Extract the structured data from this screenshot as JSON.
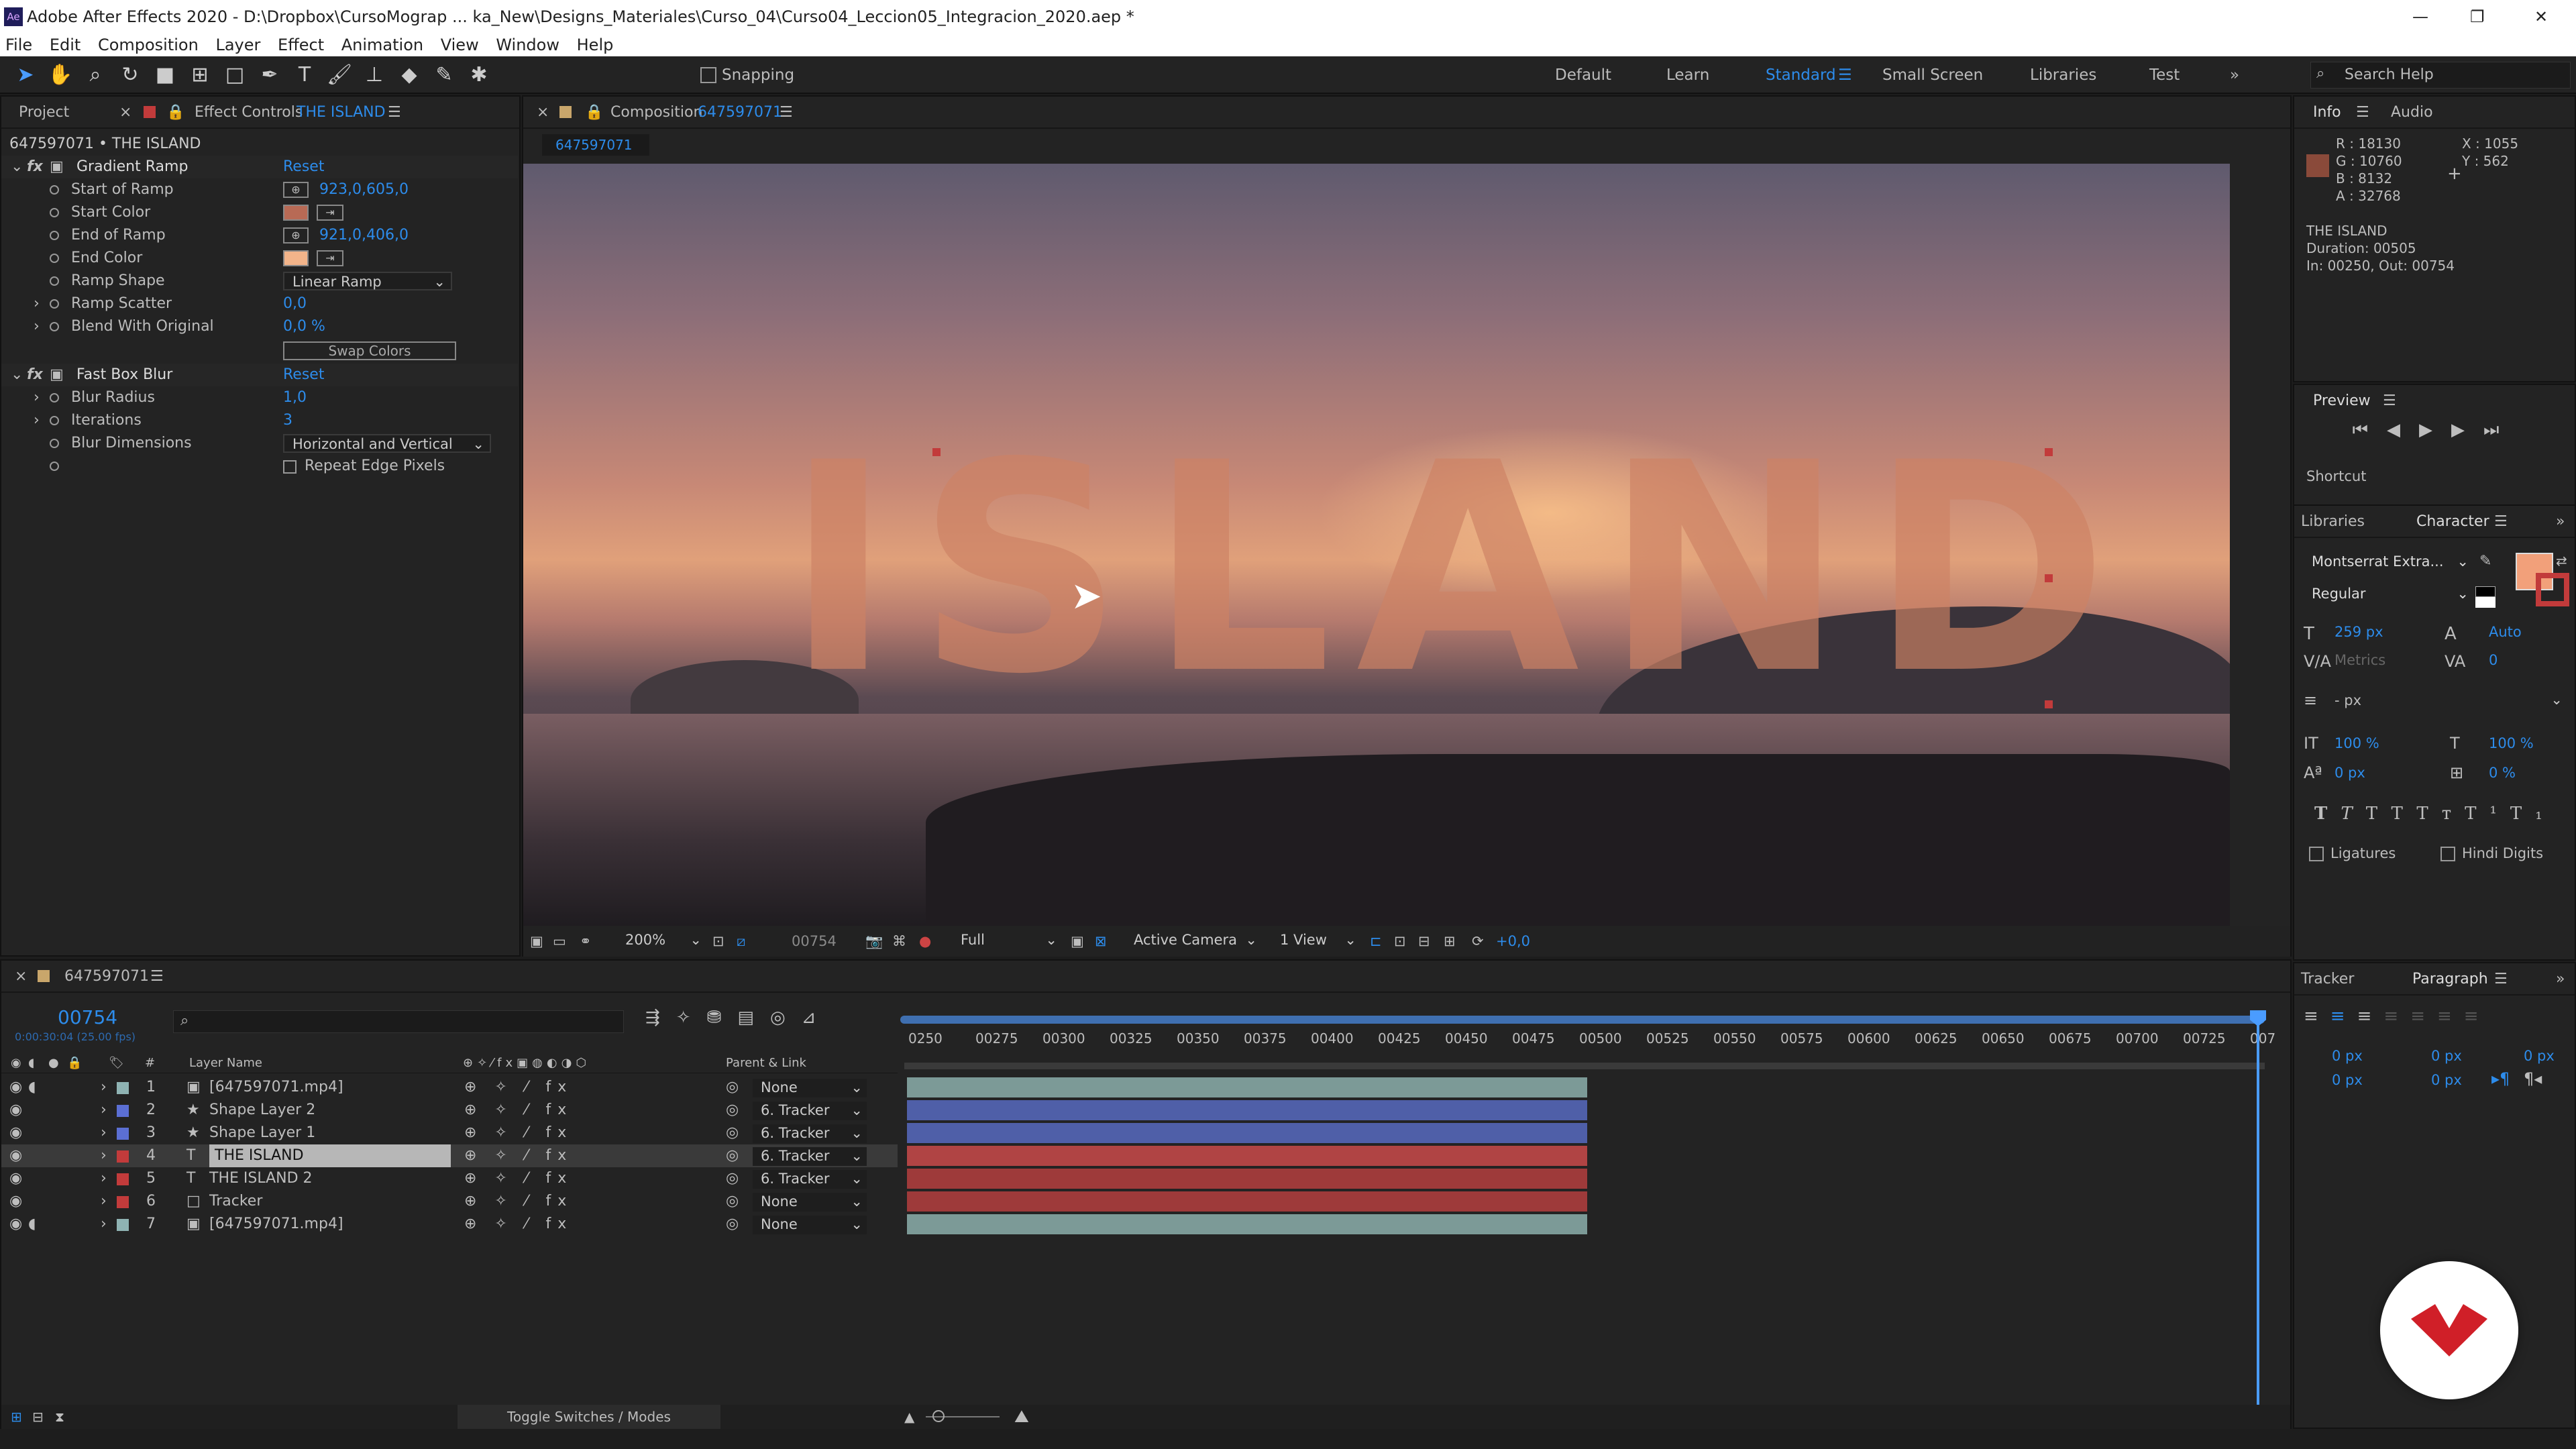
{
  "app": {
    "title": "Adobe After Effects 2020 - D:\\Dropbox\\CursoMograp ... ka_New\\Designs_Materiales\\Curso_04\\Curso04_Leccion05_Integracion_2020.aep *",
    "icon": "Ae"
  },
  "menu": [
    "File",
    "Edit",
    "Composition",
    "Layer",
    "Effect",
    "Animation",
    "View",
    "Window",
    "Help"
  ],
  "toolbar": {
    "snapping": "Snapping",
    "workspaces": [
      "Default",
      "Learn",
      "Standard",
      "Small Screen",
      "Libraries",
      "Test"
    ],
    "search": "Search Help"
  },
  "left_panel": {
    "tab_project": "Project",
    "tab_effect": "Effect Controls",
    "effect_layer": "THE ISLAND",
    "breadcrumb": "647597071 • THE ISLAND",
    "gradient_ramp": {
      "name": "Gradient Ramp",
      "reset": "Reset",
      "start_label": "Start of Ramp",
      "start_value": "923,0,605,0",
      "start_color_label": "Start Color",
      "start_color": "#b86a55",
      "end_label": "End of Ramp",
      "end_value": "921,0,406,0",
      "end_color_label": "End Color",
      "end_color": "#f2b48a",
      "shape_label": "Ramp Shape",
      "shape_value": "Linear Ramp",
      "scatter_label": "Ramp Scatter",
      "scatter_value": "0,0",
      "blend_label": "Blend With Original",
      "blend_value": "0,0 %",
      "swap": "Swap Colors"
    },
    "fast_box_blur": {
      "name": "Fast Box Blur",
      "reset": "Reset",
      "radius_label": "Blur Radius",
      "radius_value": "1,0",
      "iter_label": "Iterations",
      "iter_value": "3",
      "dims_label": "Blur Dimensions",
      "dims_value": "Horizontal and Vertical",
      "repeat_label": "Repeat Edge Pixels"
    }
  },
  "comp": {
    "tab": "Composition",
    "comp_name": "647597071",
    "subtab": "647597071",
    "text": "ISLAND",
    "zoom": "200%",
    "frame": "00754",
    "resolution": "Full",
    "camera": "Active Camera",
    "views": "1 View",
    "exposure": "+0,0"
  },
  "info": {
    "tab": "Info",
    "tab2": "Audio",
    "r": "R : 18130",
    "g": "G : 10760",
    "b": "B : 8132",
    "a": "A : 32768",
    "x": "X : 1055",
    "y": "Y : 562",
    "swatch": "#8a4a3a",
    "layer": "THE ISLAND",
    "duration": "Duration: 00505",
    "inout": "In: 00250, Out: 00754"
  },
  "preview": {
    "title": "Preview",
    "shortcut": "Shortcut"
  },
  "character": {
    "tab_libraries": "Libraries",
    "tab": "Character",
    "font": "Montserrat Extra...",
    "style": "Regular",
    "size": "259 px",
    "leading": "Auto",
    "kerning": "Metrics",
    "tracking": "0",
    "stroke": "- px",
    "vscale": "100 %",
    "hscale": "100 %",
    "baseline": "0 px",
    "tsume": "0 %",
    "ligatures": "Ligatures",
    "hindi": "Hindi Digits",
    "fill": "#f2a07a"
  },
  "paragraph": {
    "tab_tracker": "Tracker",
    "tab": "Paragraph",
    "v1": "0 px",
    "v2": "0 px",
    "v3": "0 px",
    "v4": "0 px",
    "v5": "0 px"
  },
  "timeline": {
    "tab": "647597071",
    "timecode": "00754",
    "sub": "0:00:30:04 (25.00 fps)",
    "col_name": "Layer Name",
    "col_parent": "Parent & Link",
    "col_hash": "#",
    "toggle": "Toggle Switches / Modes",
    "ruler": [
      "0250",
      "00275",
      "00300",
      "00325",
      "00350",
      "00375",
      "00400",
      "00425",
      "00450",
      "00475",
      "00500",
      "00525",
      "00550",
      "00575",
      "00600",
      "00625",
      "00650",
      "00675",
      "00700",
      "00725",
      "007"
    ],
    "layers": [
      {
        "num": "1",
        "name": "[647597071.mp4]",
        "type": "▣",
        "color": "#8fb3b3",
        "parent": "None",
        "bar": "#7c9a97",
        "audio": true
      },
      {
        "num": "2",
        "name": "Shape Layer 2",
        "type": "★",
        "color": "#5b6fd4",
        "parent": "6. Tracker",
        "bar": "#4f5fa8"
      },
      {
        "num": "3",
        "name": "Shape Layer 1",
        "type": "★",
        "color": "#5b6fd4",
        "parent": "6. Tracker",
        "bar": "#4f5fa8"
      },
      {
        "num": "4",
        "name": "THE ISLAND",
        "type": "T",
        "color": "#c23b3b",
        "parent": "6. Tracker",
        "bar": "#b04444",
        "selected": true
      },
      {
        "num": "5",
        "name": "THE ISLAND 2",
        "type": "T",
        "color": "#c23b3b",
        "parent": "6. Tracker",
        "bar": "#9e3a3a"
      },
      {
        "num": "6",
        "name": "Tracker",
        "type": "□",
        "color": "#c23b3b",
        "parent": "None",
        "bar": "#9e3a3a"
      },
      {
        "num": "7",
        "name": "[647597071.mp4]",
        "type": "▣",
        "color": "#8fb3b3",
        "parent": "None",
        "bar": "#7c9a97",
        "audio": true
      }
    ]
  },
  "brand": {
    "logo": "v-logo-icon",
    "color": "#d01f28"
  }
}
